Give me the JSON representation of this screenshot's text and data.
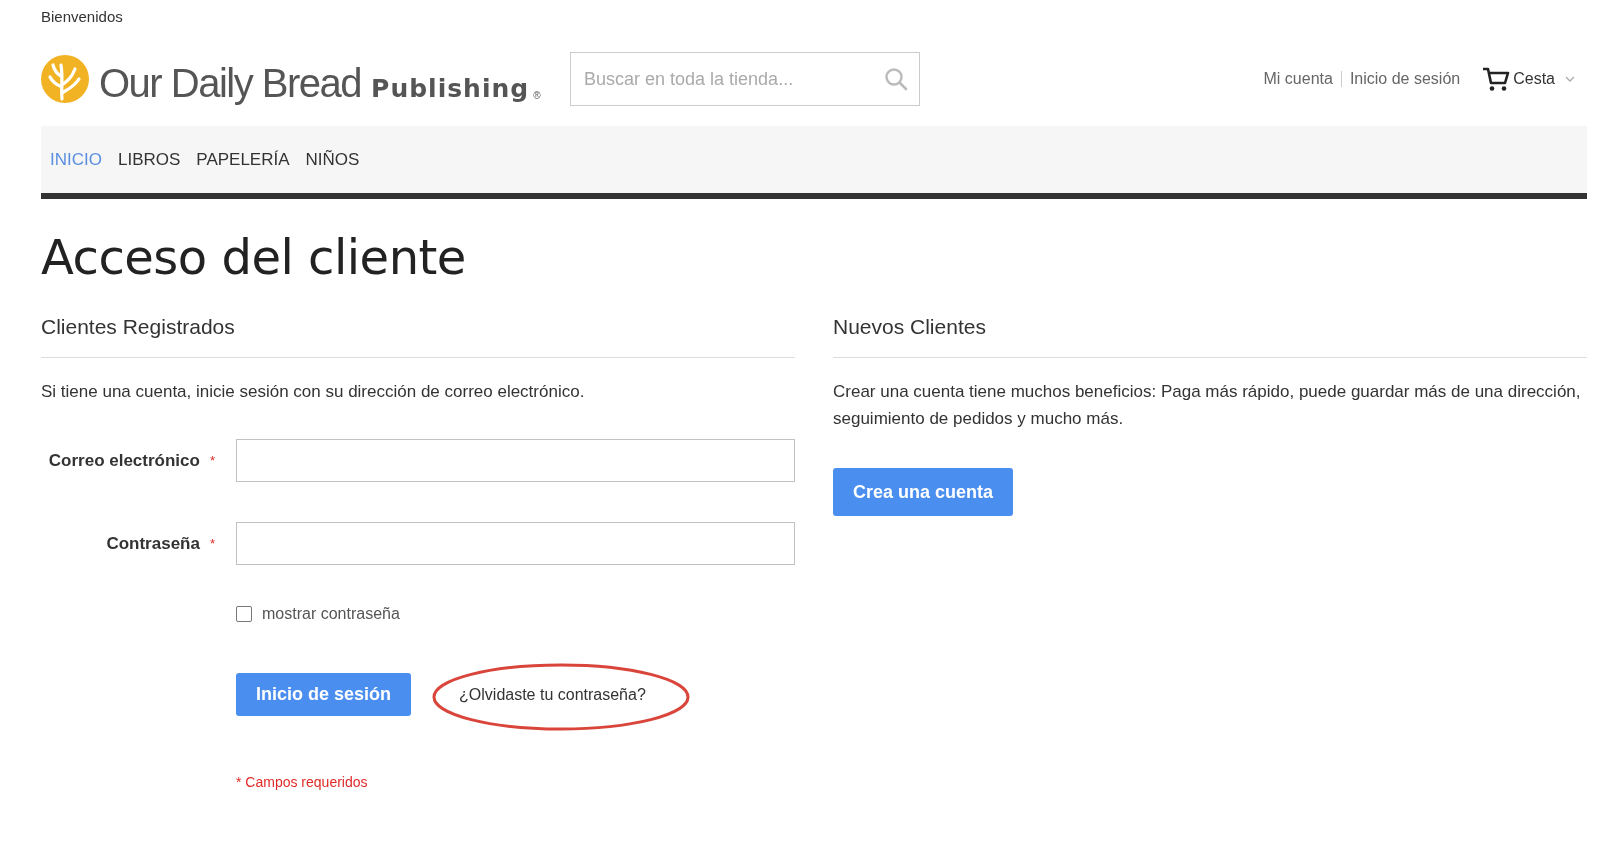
{
  "header": {
    "welcome": "Bienvenidos",
    "logo": {
      "name": "Our Daily Bread",
      "sub": "Publishing",
      "mark": "®"
    },
    "search": {
      "placeholder": "Buscar en toda la tienda..."
    },
    "links": [
      "Mi cuenta",
      "Inicio de sesión"
    ],
    "cart": "Cesta"
  },
  "nav": [
    {
      "label": "INICIO",
      "selected": true
    },
    {
      "label": "LIBROS",
      "selected": false
    },
    {
      "label": "PAPELERÍA",
      "selected": false
    },
    {
      "label": "NIÑOS",
      "selected": false
    }
  ],
  "page_title": "Acceso del cliente",
  "registered": {
    "title": "Clientes Registrados",
    "intro": "Si tiene una cuenta, inicie sesión con su dirección de correo electrónico.",
    "fields": [
      {
        "label": "Correo electrónico",
        "required": "*"
      },
      {
        "label": "Contraseña",
        "required": "*"
      }
    ],
    "show_password": {
      "label": "mostrar contraseña",
      "checked": false
    },
    "submit": "Inicio de sesión",
    "forgot": {
      "label": "¿Olvidaste tu contraseña?",
      "circled": true
    },
    "required_note": "* Campos requeridos"
  },
  "new_customers": {
    "title": "Nuevos Clientes",
    "text": "Crear una cuenta tiene muchos beneficios: Paga más rápido, puede guardar más de una dirección, seguimiento de pedidos y mucho más.",
    "button": "Crea una cuenta"
  }
}
